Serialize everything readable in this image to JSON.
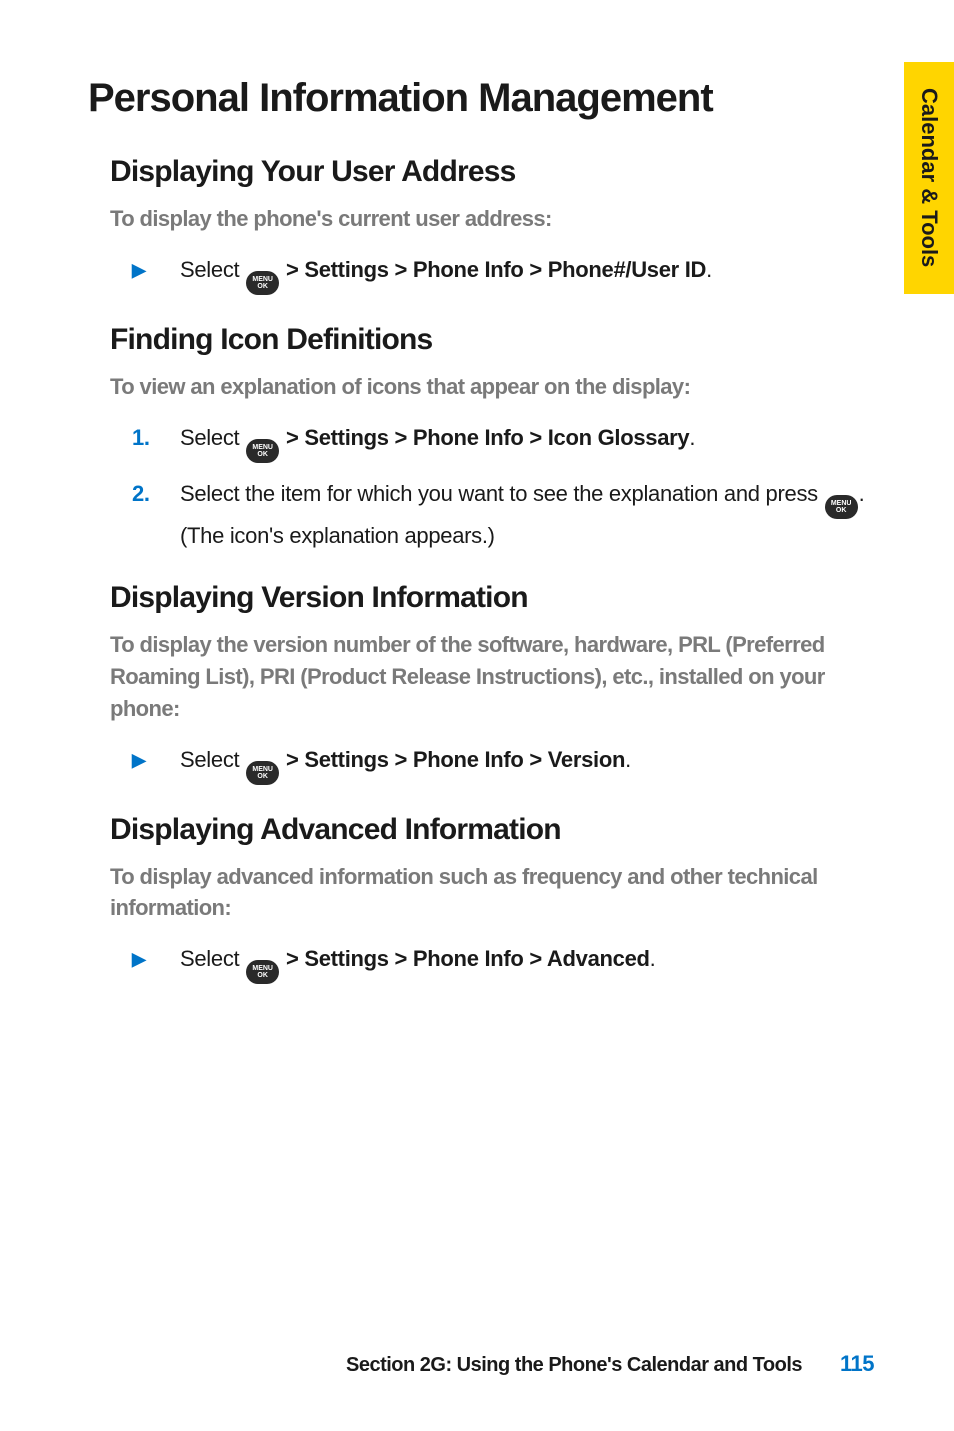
{
  "side_tab": "Calendar & Tools",
  "title": "Personal Information Management",
  "sections": [
    {
      "heading": "Displaying Your User Address",
      "intro": "To display the phone's current user address:",
      "steps": [
        {
          "marker_type": "triangle",
          "before": "Select ",
          "bold": " > Settings > Phone Info > Phone#/User ID",
          "after": "."
        }
      ]
    },
    {
      "heading": "Finding Icon Definitions",
      "intro": "To view an explanation of icons that appear on the display:",
      "steps": [
        {
          "marker_type": "num",
          "marker": "1.",
          "before": "Select ",
          "bold": " > Settings > Phone Info > Icon Glossary",
          "after": "."
        },
        {
          "marker_type": "num",
          "marker": "2.",
          "before": "Select the item for which you want to see the explanation and press ",
          "bold": "",
          "after": ". (The icon's explanation appears.)"
        }
      ]
    },
    {
      "heading": "Displaying Version Information",
      "intro": "To display the version number of the software, hardware, PRL (Preferred Roaming List), PRI (Product Release Instructions), etc., installed on your phone:",
      "steps": [
        {
          "marker_type": "triangle",
          "before": "Select ",
          "bold": " > Settings > Phone Info > Version",
          "after": "."
        }
      ]
    },
    {
      "heading": "Displaying Advanced Information",
      "intro": "To display advanced information such as frequency and other technical information:",
      "steps": [
        {
          "marker_type": "triangle",
          "before": "Select ",
          "bold": " > Settings > Phone Info > Advanced",
          "after": "."
        }
      ]
    }
  ],
  "menu_ok": {
    "line1": "MENU",
    "line2": "OK"
  },
  "footer": {
    "text": "Section 2G: Using the Phone's Calendar and Tools",
    "page": "115"
  }
}
